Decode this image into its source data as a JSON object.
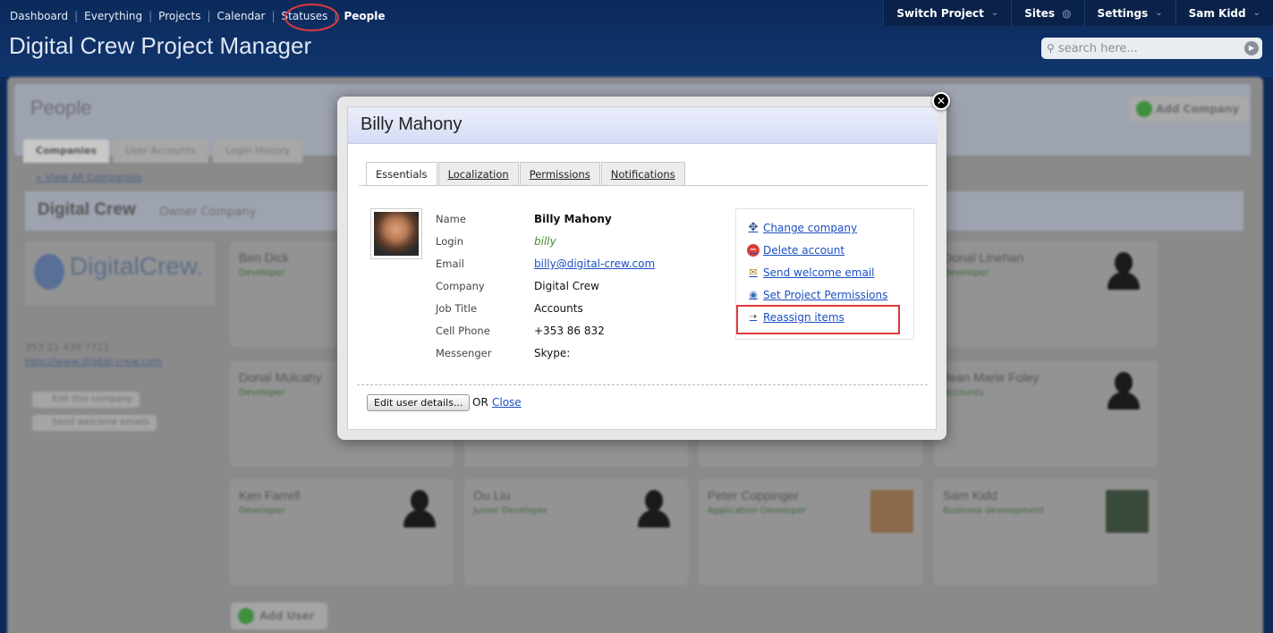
{
  "topnav": {
    "items": [
      "Dashboard",
      "Everything",
      "Projects",
      "Calendar",
      "Statuses",
      "People"
    ]
  },
  "rightnav": {
    "switch_project": "Switch Project",
    "sites": "Sites",
    "settings": "Settings",
    "user": "Sam Kidd"
  },
  "app_title": "Digital Crew Project Manager",
  "search": {
    "placeholder": "search here..."
  },
  "background": {
    "page_title": "People",
    "add_company": "Add Company",
    "tabs": [
      "Companies",
      "User Accounts",
      "Login History"
    ],
    "view_all": "« View All Companies",
    "company_name": "Digital Crew",
    "company_sub": "Owner Company",
    "logo_text": "DigitalCrew.",
    "phone": "353 21 439 7711",
    "website": "http://www.digital-crew.com",
    "edit_company": "Edit this company",
    "send_welcome": "Send welcome emails",
    "add_user": "Add User",
    "cards": [
      {
        "name": "Ben Dick",
        "role": "Developer"
      },
      {
        "name": "Donal Linehan",
        "role": "Developer"
      },
      {
        "name": "Donal Mulcahy",
        "role": "Developer"
      },
      {
        "name": "Jean Marie Foley",
        "role": "Accounts"
      },
      {
        "name": "Ken Farrell",
        "role": "Developer"
      },
      {
        "name": "Ou Liu",
        "role": "Junior Developer"
      },
      {
        "name": "Peter Coppinger",
        "role": "Application Developer"
      },
      {
        "name": "Sam Kidd",
        "role": "Business development"
      }
    ]
  },
  "modal": {
    "title": "Billy Mahony",
    "tabs": [
      "Essentials",
      "Localization",
      "Permissions",
      "Notifications"
    ],
    "fields": [
      {
        "label": "Name",
        "value": "Billy Mahony"
      },
      {
        "label": "Login",
        "value": "billy"
      },
      {
        "label": "Email",
        "value": "billy@digital-crew.com"
      },
      {
        "label": "Company",
        "value": "Digital Crew"
      },
      {
        "label": "Job Title",
        "value": "Accounts"
      },
      {
        "label": "Cell Phone",
        "value": "+353 86 832"
      },
      {
        "label": "Messenger",
        "value": "Skype:"
      }
    ],
    "actions": [
      {
        "label": "Change company",
        "icon": "move-icon"
      },
      {
        "label": "Delete account",
        "icon": "delete-icon"
      },
      {
        "label": "Send welcome email",
        "icon": "user-email-icon"
      },
      {
        "label": "Set Project Permissions",
        "icon": "eye-icon"
      },
      {
        "label": "Reassign items",
        "icon": "arrow-right-icon"
      }
    ],
    "edit_button": "Edit user details...",
    "or_text": "OR",
    "close_link": "Close"
  },
  "colors": {
    "accent_link": "#1a4fc2",
    "highlight_red": "#e0393e",
    "login_green": "#4a8a2a"
  }
}
